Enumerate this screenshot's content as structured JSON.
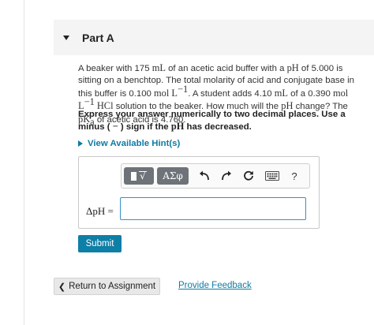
{
  "part": {
    "title": "Part A"
  },
  "problem": {
    "t1": "A beaker with 175 ",
    "m1": "mL",
    "t2": " of an acetic acid buffer with a ",
    "m2": "pH",
    "t3": " of 5.000 is sitting on a benchtop. The total molarity of acid and conjugate base in this buffer is 0.100 ",
    "m3": "mol L",
    "m3exp": "−1",
    "t4": ". A student adds 4.10 ",
    "m4": "mL",
    "t5": " of a 0.390 ",
    "m5": "mol L",
    "m5exp": "−1",
    "m6": " HCl",
    "t6": " solution to the beaker. How much will the ",
    "m7": "pH",
    "t7": " change? The ",
    "m8": "pK",
    "m8sub": "a",
    "t8": " of acetic acid is 4.760."
  },
  "instruction": {
    "t1": "Express your answer numerically to two decimal places. Use a minus ( ",
    "m1": "−",
    "t2": " ) sign if the ",
    "m2": "pH",
    "t3": " has decreased."
  },
  "hints": {
    "label": "View Available Hint(s)"
  },
  "toolbar": {
    "template_glyph": "√",
    "symbols_label": "ΑΣφ",
    "help_label": "?"
  },
  "answer": {
    "label": "ΔpH =",
    "value": ""
  },
  "buttons": {
    "submit": "Submit",
    "return": "Return to Assignment",
    "return_chevron": "❮",
    "feedback": "Provide Feedback"
  },
  "colors": {
    "accent": "#0e7ba3",
    "submit_bg": "#0e7fa6",
    "toolbar_btn": "#6d7378",
    "header_bg": "#f4f4f4"
  },
  "icons": [
    "caret-down-icon",
    "triangle-right-icon",
    "template-icon",
    "symbols-icon",
    "undo-icon",
    "redo-icon",
    "reset-icon",
    "keyboard-icon",
    "help-icon",
    "chevron-left-icon"
  ]
}
